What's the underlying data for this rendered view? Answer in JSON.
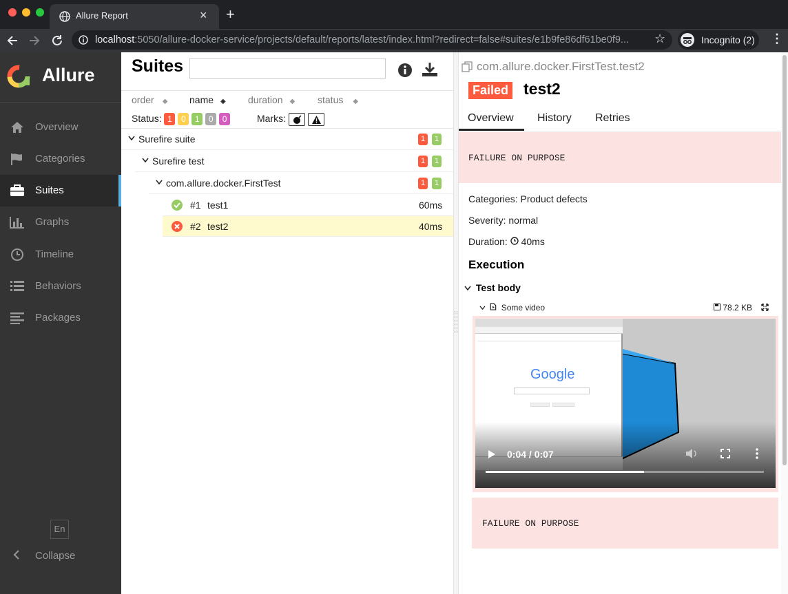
{
  "browser": {
    "tab_title": "Allure Report",
    "url_host": "localhost",
    "url_path": ":5050/allure-docker-service/projects/default/reports/latest/index.html?redirect=false#suites/e1b9fe86df61be0f9...",
    "incognito_label": "Incognito (2)"
  },
  "sidebar": {
    "brand": "Allure",
    "items": [
      {
        "label": "Overview",
        "icon": "home-icon"
      },
      {
        "label": "Categories",
        "icon": "flag-icon"
      },
      {
        "label": "Suites",
        "icon": "briefcase-icon"
      },
      {
        "label": "Graphs",
        "icon": "bar-chart-icon"
      },
      {
        "label": "Timeline",
        "icon": "clock-icon"
      },
      {
        "label": "Behaviors",
        "icon": "list-icon"
      },
      {
        "label": "Packages",
        "icon": "align-left-icon"
      }
    ],
    "active_item": "Suites",
    "language": "En",
    "collapse_label": "Collapse"
  },
  "suites": {
    "title": "Suites",
    "search_placeholder": "",
    "sort_headers": [
      "order",
      "name",
      "duration",
      "status"
    ],
    "status_label": "Status:",
    "status_counts": [
      "1",
      "0",
      "1",
      "0",
      "0"
    ],
    "marks_label": "Marks:",
    "tree": {
      "suite": {
        "name": "Surefire suite",
        "failed": "1",
        "passed": "1"
      },
      "test": {
        "name": "Surefire test",
        "failed": "1",
        "passed": "1"
      },
      "class": {
        "name": "com.allure.docker.FirstTest",
        "failed": "1",
        "passed": "1"
      },
      "cases": [
        {
          "num": "#1",
          "name": "test1",
          "duration": "60ms",
          "status": "passed"
        },
        {
          "num": "#2",
          "name": "test2",
          "duration": "40ms",
          "status": "failed"
        }
      ]
    }
  },
  "detail": {
    "full_name": "com.allure.docker.FirstTest.test2",
    "status": "Failed",
    "name": "test2",
    "tabs": [
      "Overview",
      "History",
      "Retries"
    ],
    "message": "FAILURE ON PURPOSE",
    "categories": "Categories: Product defects",
    "severity": "Severity: normal",
    "duration_label": "Duration:",
    "duration": "40ms",
    "execution_title": "Execution",
    "test_body_label": "Test body",
    "attachment_name": "Some video",
    "attachment_size": "78.2 KB",
    "video_time": "0:04 / 0:07",
    "video_progress": 0.57,
    "embedded_google": "Google",
    "message_2": "FAILURE ON PURPOSE"
  },
  "colors": {
    "failed": "#fd5a3e",
    "broken": "#ffd050",
    "passed": "#97cc64",
    "skipped": "#aaaaaa",
    "unknown": "#d35ebe",
    "sidebar_bg": "#343434",
    "active_accent": "#59afe1",
    "error_bg": "#fde2e2",
    "selected_row": "#fffacd"
  }
}
